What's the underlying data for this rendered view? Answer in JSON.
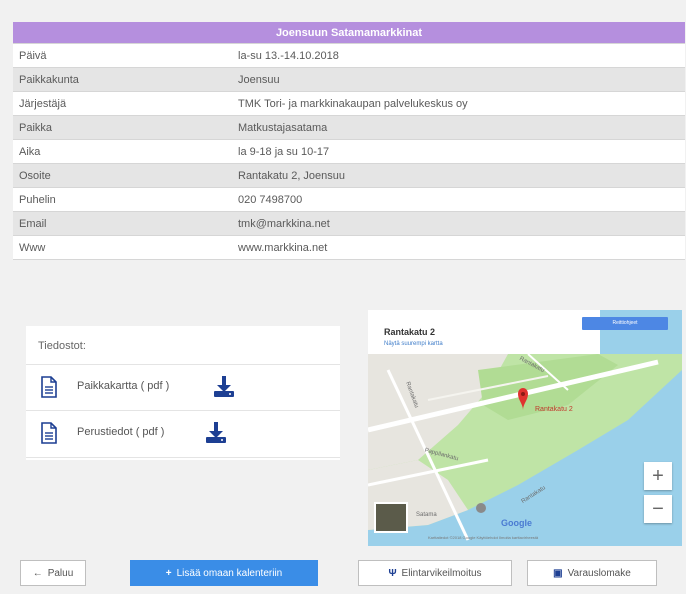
{
  "event": {
    "title": "Joensuun Satamamarkkinat",
    "rows": [
      {
        "label": "Päivä",
        "value": "la-su 13.-14.10.2018"
      },
      {
        "label": "Paikkakunta",
        "value": "Joensuu"
      },
      {
        "label": "Järjestäjä",
        "value": "TMK Tori- ja markkinakaupan palvelukeskus oy"
      },
      {
        "label": "Paikka",
        "value": "Matkustajasatama"
      },
      {
        "label": "Aika",
        "value": "la 9-18 ja su 10-17"
      },
      {
        "label": "Osoite",
        "value": "Rantakatu 2, Joensuu"
      },
      {
        "label": "Puhelin",
        "value": "020 7498700"
      },
      {
        "label": "Email",
        "value": "tmk@markkina.net"
      },
      {
        "label": "Www",
        "value": "www.markkina.net"
      }
    ]
  },
  "files": {
    "title": "Tiedostot:",
    "items": [
      {
        "label": "Paikkakartta ( pdf )",
        "icon": "document-icon"
      },
      {
        "label": "Perustiedot ( pdf )",
        "icon": "document-icon"
      }
    ]
  },
  "map": {
    "place_title": "Rantakatu 2",
    "place_link": "Näytä suurempi kartta",
    "directions_button": "Reittiohjeet",
    "pin_label": "Rantakatu 2",
    "streets": [
      "Rantakatu",
      "Rantakatu",
      "Pappilankatu",
      "Rantakatu"
    ],
    "harbour_label": "Satama",
    "zoom_in": "+",
    "zoom_out": "−",
    "attribution": "Google",
    "footer": "Karttatiedot ©2018 Google   Käyttöehdot   Ilmoita karttavirheestä"
  },
  "buttons": {
    "back": "Paluu",
    "back_icon": "←",
    "calendar": "Lisää omaan kalenteriin",
    "calendar_icon": "+",
    "restaurant": "Elintarvikeilmoitus",
    "restaurant_icon": "Ψ",
    "booking": "Varauslomake",
    "booking_icon": "▣"
  },
  "colors": {
    "header_purple": "#b58fde",
    "link_blue": "#2c4f9e",
    "primary_button": "#3a8de7",
    "download_icon": "#1d3f93",
    "map_water": "#9ad0ea",
    "map_land": "#bfe4a6"
  }
}
